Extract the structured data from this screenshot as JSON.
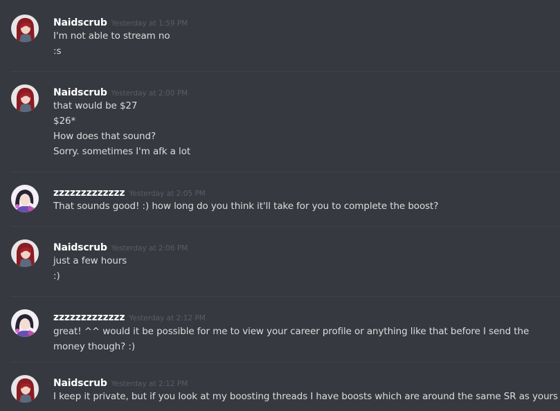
{
  "messages": [
    {
      "author": "Naidscrub",
      "time": "Yesterday at 1:59 PM",
      "avatar": "red-hair-avatar",
      "lines": [
        "I'm not able to stream no",
        ":s"
      ]
    },
    {
      "author": "Naidscrub",
      "time": "Yesterday at 2:00 PM",
      "avatar": "red-hair-avatar",
      "lines": [
        "that would be $27",
        "$26*",
        "How does that sound?",
        "Sorry. sometimes I'm afk a lot"
      ]
    },
    {
      "author": "zzzzzzzzzzzzz",
      "time": "Yesterday at 2:05 PM",
      "avatar": "dark-hair-avatar",
      "lines": [
        "That sounds good! :) how long do you think it'll take for you to complete the boost?"
      ]
    },
    {
      "author": "Naidscrub",
      "time": "Yesterday at 2:06 PM",
      "avatar": "red-hair-avatar",
      "lines": [
        "just a few hours",
        ":)"
      ]
    },
    {
      "author": "zzzzzzzzzzzzz",
      "time": "Yesterday at 2:12 PM",
      "avatar": "dark-hair-avatar",
      "lines": [
        "great! ^^ would it be possible for me to view your career profile or anything like that before I send the money though? :)"
      ]
    },
    {
      "author": "Naidscrub",
      "time": "Yesterday at 2:12 PM",
      "avatar": "red-hair-avatar",
      "lines": [
        "I keep it private, but if you look at my boosting threads I have boosts which are around the same SR as yours"
      ]
    }
  ],
  "colors": {
    "background": "#36393f",
    "username": "#ffffff",
    "timestamp": "#72767d",
    "text": "#dcddde",
    "divider": "#3f4247"
  }
}
